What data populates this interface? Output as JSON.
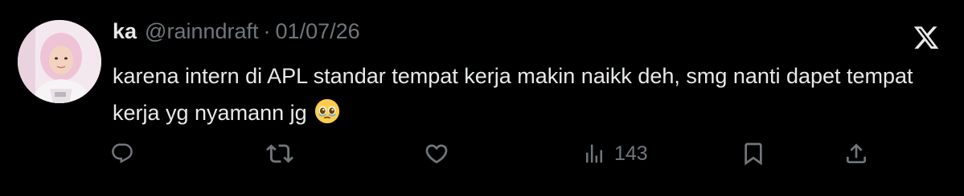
{
  "author": {
    "name": "ka",
    "handle": "@rainndraft",
    "separator": "·",
    "date": "01/07/26"
  },
  "tweet": {
    "text": "karena intern di APL standar tempat kerja makin naikk deh, smg nanti dapet tempat kerja yg nyamann jg",
    "emoji": "🥹"
  },
  "actions": {
    "views": "143"
  },
  "icons": {
    "logo": "x-logo-icon",
    "reply": "reply-icon",
    "retweet": "retweet-icon",
    "like": "heart-icon",
    "views": "bar-chart-icon",
    "bookmark": "bookmark-icon",
    "share": "share-icon"
  },
  "colors": {
    "background": "#000000",
    "primary_text": "#e7e9ea",
    "secondary_text": "#71767b"
  }
}
